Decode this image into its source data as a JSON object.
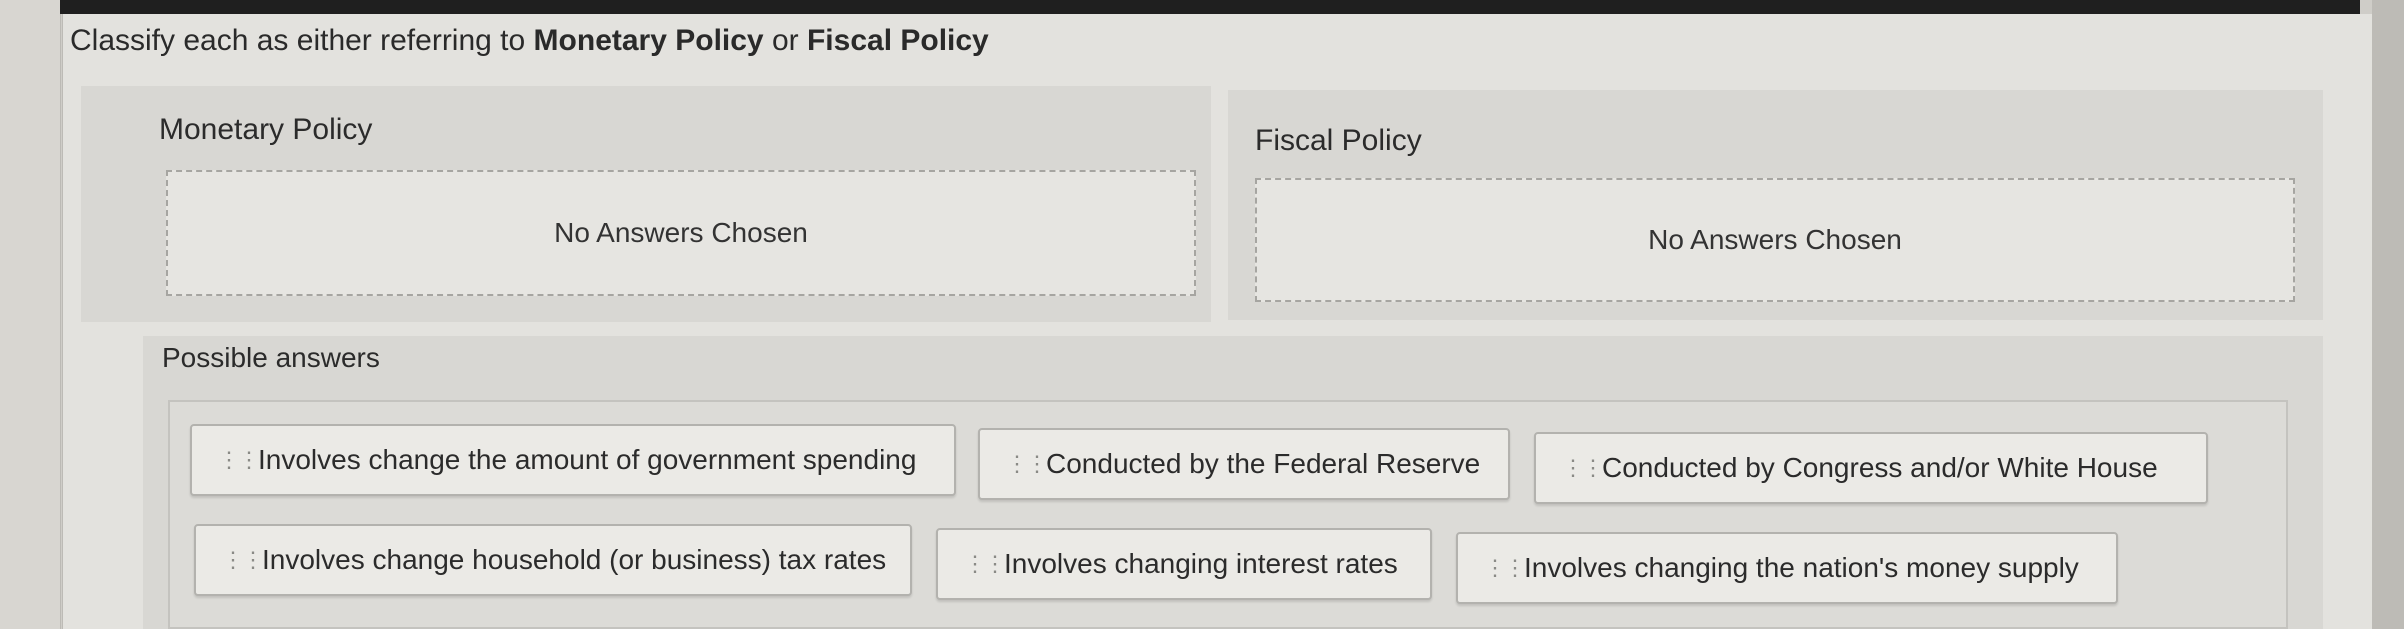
{
  "question": {
    "prefix": "Classify each as either referring to ",
    "term_a": "Monetary Policy",
    "connector": " or ",
    "term_b": "Fiscal Policy"
  },
  "categories": [
    {
      "title": "Monetary Policy",
      "empty_text": "No Answers Chosen"
    },
    {
      "title": "Fiscal Policy",
      "empty_text": "No Answers Chosen"
    }
  ],
  "possible_answers": {
    "title": "Possible answers",
    "items": [
      {
        "label": "Involves change the amount of government spending",
        "icon": "drag-handle-icon"
      },
      {
        "label": "Conducted by the Federal Reserve",
        "icon": "drag-handle-icon"
      },
      {
        "label": "Conducted by Congress and/or White House",
        "icon": "drag-handle-icon"
      },
      {
        "label": "Involves change household (or business) tax rates",
        "icon": "drag-handle-icon"
      },
      {
        "label": "Involves changing interest rates",
        "icon": "drag-handle-icon"
      },
      {
        "label": "Involves changing the nation's money supply",
        "icon": "drag-handle-icon"
      }
    ]
  },
  "colors": {
    "background": "#cfcdc8",
    "panel": "#d8d7d3",
    "chip": "#ebeae6"
  }
}
